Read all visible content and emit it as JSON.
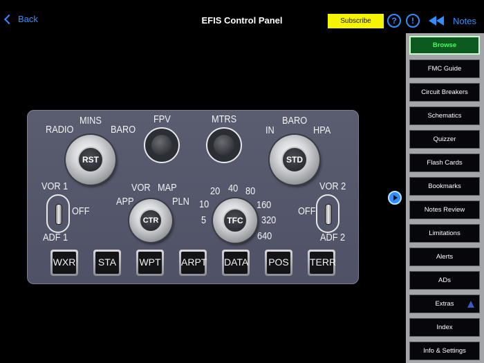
{
  "header": {
    "back_label": "Back",
    "title": "EFIS Control Panel",
    "subscribe_label": "Subscribe",
    "help_icon": "?",
    "alert_icon": "!",
    "notes_label": "Notes",
    "accent_color": "#2f8fff",
    "subscribe_color": "#f7f400"
  },
  "sidebar": {
    "items": [
      {
        "label": "Browse",
        "active": true
      },
      {
        "label": "FMC Guide"
      },
      {
        "label": "Circuit Breakers"
      },
      {
        "label": "Schematics"
      },
      {
        "label": "Quizzer"
      },
      {
        "label": "Flash Cards"
      },
      {
        "label": "Bookmarks"
      },
      {
        "label": "Notes Review"
      },
      {
        "label": "Limitations"
      },
      {
        "label": "Alerts"
      },
      {
        "label": "ADs"
      },
      {
        "label": "Extras"
      },
      {
        "label": "Index"
      },
      {
        "label": "Info & Settings"
      }
    ]
  },
  "panel": {
    "left_knob": {
      "center": "RST",
      "labels": [
        "RADIO",
        "MINS",
        "BARO"
      ]
    },
    "fpv_label": "FPV",
    "mtrs_label": "MTRS",
    "right_knob": {
      "center": "STD",
      "labels": [
        "IN",
        "BARO",
        "HPA"
      ]
    },
    "left_switch": {
      "top": "VOR 1",
      "side": "OFF",
      "bottom": "ADF 1"
    },
    "right_switch": {
      "top": "VOR 2",
      "side": "OFF",
      "bottom": "ADF 2"
    },
    "mode_knob": {
      "center": "CTR",
      "labels": [
        "VOR",
        "MAP",
        "APP",
        "PLN"
      ]
    },
    "range_knob": {
      "center": "TFC",
      "labels": [
        "20",
        "40",
        "80",
        "10",
        "160",
        "5",
        "320",
        "640"
      ]
    },
    "keys": [
      "WXR",
      "STA",
      "WPT",
      "ARPT",
      "DATA",
      "POS",
      "TERR"
    ]
  }
}
